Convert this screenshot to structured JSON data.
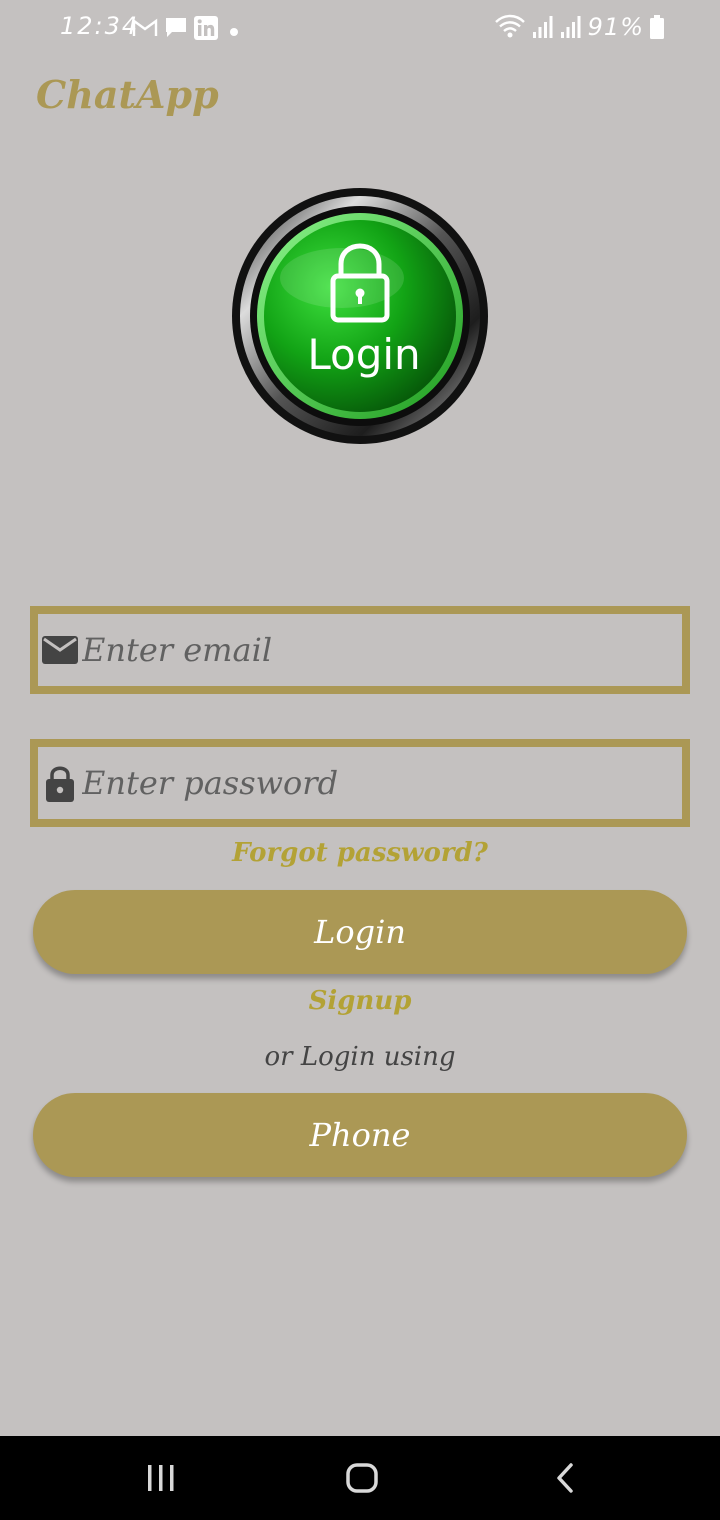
{
  "status_bar": {
    "time": "12:34",
    "battery": "91%",
    "icons": [
      "gmail-icon",
      "message-icon",
      "linkedin-icon",
      "dot-icon",
      "wifi-icon",
      "signal-icon",
      "signal-icon",
      "battery-icon"
    ]
  },
  "app": {
    "title": "ChatApp"
  },
  "logo": {
    "label": "Login",
    "icon": "lock-icon"
  },
  "email": {
    "placeholder": "Enter email",
    "value": "",
    "icon": "mail-icon"
  },
  "password": {
    "placeholder": "Enter password",
    "value": "",
    "icon": "lock-icon"
  },
  "forgot_label": "Forgot password?",
  "login_button": "Login",
  "signup_label": "Signup",
  "or_label": "or Login using",
  "phone_button": "Phone",
  "nav": [
    "recents-icon",
    "home-icon",
    "back-icon"
  ],
  "colors": {
    "accent": "#ab9855",
    "link": "#b3a235",
    "background": "#c4c1c0"
  }
}
